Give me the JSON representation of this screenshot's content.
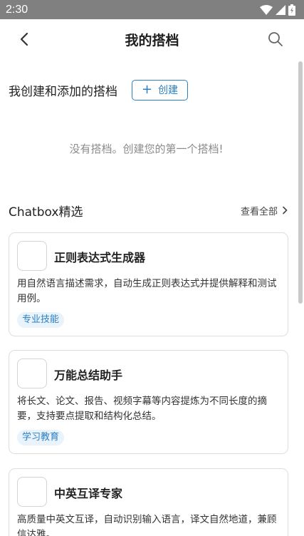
{
  "status_bar": {
    "time": "2:30"
  },
  "header": {
    "title": "我的搭档"
  },
  "my_partners": {
    "section_title": "我创建和添加的搭档",
    "create_label": "创建",
    "empty_text": "没有搭档。创建您的第一个搭档!"
  },
  "featured": {
    "section_title": "Chatbox精选",
    "view_all_label": "查看全部",
    "cards": [
      {
        "name": "正则表达式生成器",
        "description": "用自然语言描述需求，自动生成正则表达式并提供解释和测试用例。",
        "tag": "专业技能"
      },
      {
        "name": "万能总结助手",
        "description": "将长文、论文、报告、视频字幕等内容提炼为不同长度的摘要，支持要点提取和结构化总结。",
        "tag": "学习教育"
      },
      {
        "name": "中英互译专家",
        "description": "高质量中英文互译，自动识别输入语言，译文自然地道，兼顾信达雅。",
        "tag": ""
      }
    ]
  },
  "colors": {
    "accent": "#2d7fc4",
    "status_bar": "#808080",
    "tag_bg": "#e8f3fb"
  }
}
